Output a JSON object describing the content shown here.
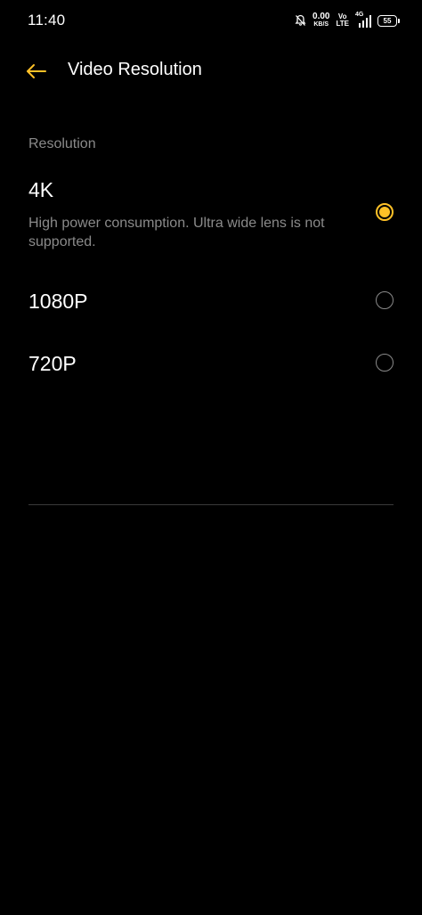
{
  "status_bar": {
    "time": "11:40",
    "net_speed_value": "0.00",
    "net_speed_unit": "KB/S",
    "volte_top": "Vo",
    "volte_bottom": "LTE",
    "network_type": "4G",
    "battery_level": "55"
  },
  "header": {
    "title": "Video Resolution"
  },
  "section": {
    "label": "Resolution"
  },
  "options": [
    {
      "label": "4K",
      "description": "High power consumption. Ultra wide lens is not supported.",
      "selected": true
    },
    {
      "label": "1080P",
      "description": "",
      "selected": false
    },
    {
      "label": "720P",
      "description": "",
      "selected": false
    }
  ],
  "colors": {
    "accent": "#ffc127",
    "background": "#000000",
    "primary_text": "#ffffff",
    "secondary_text": "#8a8a8a",
    "divider": "#3a3a3a"
  }
}
